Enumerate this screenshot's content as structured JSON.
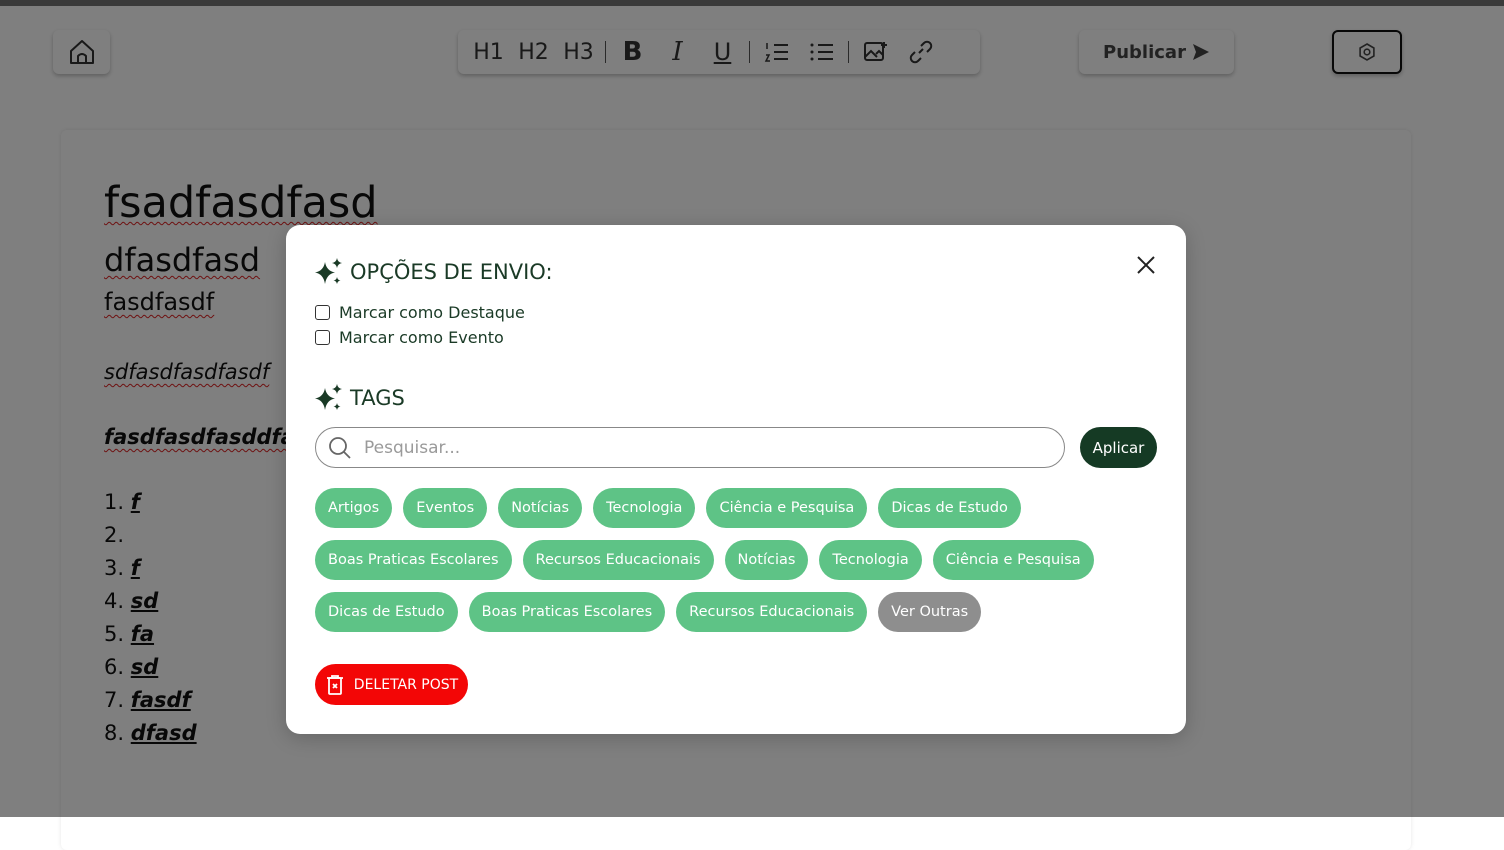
{
  "editor": {
    "toolbar": {
      "h1": "H1",
      "h2": "H2",
      "h3": "H3",
      "bold": "B",
      "italic": "I",
      "underline": "U",
      "publish_label": "Publicar"
    },
    "content": {
      "heading1": "fsadfasdfasd",
      "heading2": "dfasdfasd",
      "heading3": "fasdfasdf",
      "paragraph1": "sdfasdfasdfasdf",
      "paragraph2": "fasdfasdfasddfas",
      "list": [
        {
          "num": "1.",
          "text": "f"
        },
        {
          "num": "2.",
          "text": ""
        },
        {
          "num": "3.",
          "text": "f"
        },
        {
          "num": "4.",
          "text": "sd"
        },
        {
          "num": "5.",
          "text": "fa"
        },
        {
          "num": "6.",
          "text": "sd"
        },
        {
          "num": "7.",
          "text": "fasdf"
        },
        {
          "num": "8.",
          "text": "dfasd"
        }
      ]
    }
  },
  "modal": {
    "send_options_title": "OPÇÕES DE ENVIO:",
    "option_highlight": "Marcar como Destaque",
    "option_event": "Marcar como Evento",
    "tags_title": "TAGS",
    "search": {
      "placeholder": "Pesquisar...",
      "value": ""
    },
    "apply_label": "Aplicar",
    "tags": [
      "Artigos",
      "Eventos",
      "Notícias",
      "Tecnologia",
      "Ciência e Pesquisa",
      "Dicas de Estudo",
      "Boas Praticas Escolares",
      "Recursos Educacionais",
      "Notícias",
      "Tecnologia",
      "Ciência e Pesquisa",
      "Dicas de Estudo",
      "Boas Praticas Escolares",
      "Recursos Educacionais"
    ],
    "more_label": "Ver Outras",
    "delete_label": "DELETAR POST",
    "icons": {
      "sparkle": "sparkle-icon",
      "close": "close-icon",
      "search": "search-icon",
      "delete": "trash-icon"
    }
  },
  "colors": {
    "accent_dark": "#153a24",
    "tag_green": "#5ec386",
    "tag_gray": "#8e8e8e",
    "delete_red": "#f30606"
  }
}
